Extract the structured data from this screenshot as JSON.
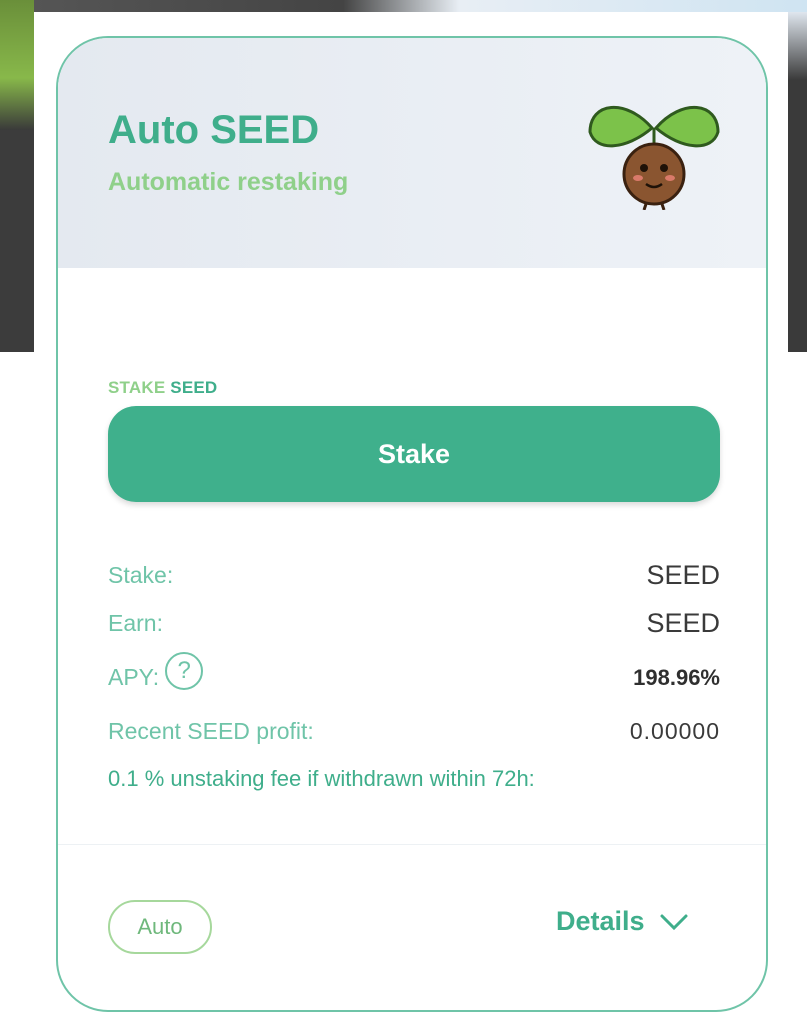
{
  "card": {
    "title": "Auto SEED",
    "subtitle": "Automatic restaking",
    "mascot_icon": "seed-sprout-mascot"
  },
  "stake_section": {
    "caption_word1": "STAKE",
    "caption_word2": "SEED",
    "stake_button_label": "Stake"
  },
  "info": {
    "stake_label": "Stake:",
    "stake_value": "SEED",
    "earn_label": "Earn:",
    "earn_value": "SEED",
    "apy_label": "APY:",
    "apy_help_icon": "question-circle-icon",
    "apy_help_glyph": "?",
    "apy_value": "198.96%",
    "profit_label": "Recent SEED profit:",
    "profit_value": "0.00000",
    "fee_note": "0.1 % unstaking fee if withdrawn within 72h:"
  },
  "footer": {
    "auto_badge": "Auto",
    "details_label": "Details",
    "details_icon": "chevron-down-icon"
  },
  "colors": {
    "accent": "#3fb08c",
    "light_green": "#8fd08a",
    "border": "#6fc4a8"
  }
}
